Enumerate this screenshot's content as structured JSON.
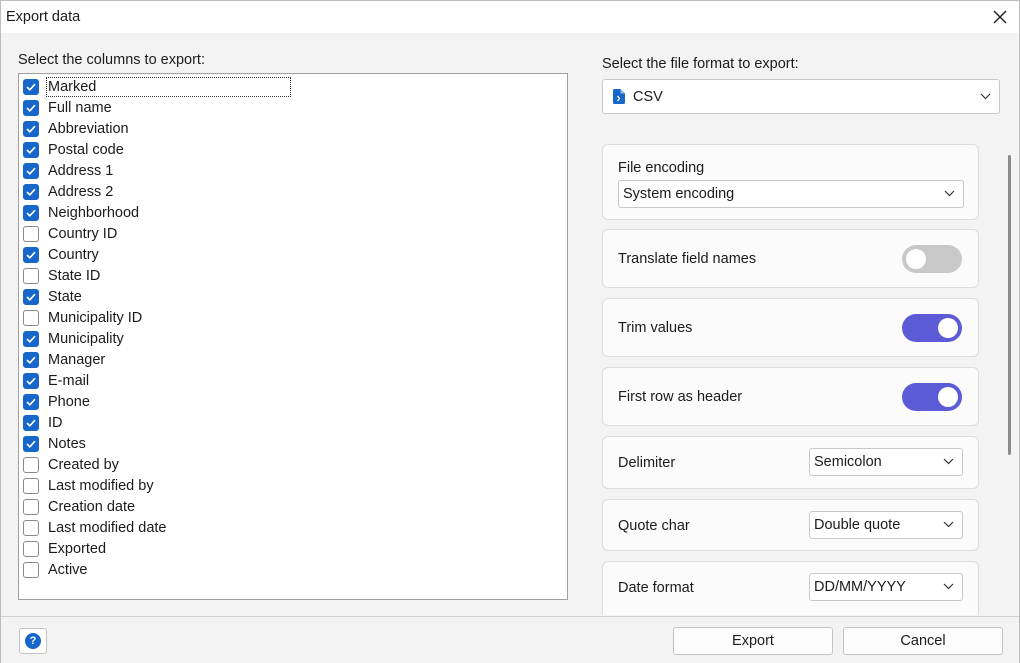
{
  "window": {
    "title": "Export data"
  },
  "columns": {
    "label": "Select the columns to export:",
    "items": [
      {
        "label": "Marked",
        "checked": true
      },
      {
        "label": "Full name",
        "checked": true
      },
      {
        "label": "Abbreviation",
        "checked": true
      },
      {
        "label": "Postal code",
        "checked": true
      },
      {
        "label": "Address 1",
        "checked": true
      },
      {
        "label": "Address 2",
        "checked": true
      },
      {
        "label": "Neighborhood",
        "checked": true
      },
      {
        "label": "Country ID",
        "checked": false
      },
      {
        "label": "Country",
        "checked": true
      },
      {
        "label": "State ID",
        "checked": false
      },
      {
        "label": "State",
        "checked": true
      },
      {
        "label": "Municipality ID",
        "checked": false
      },
      {
        "label": "Municipality",
        "checked": true
      },
      {
        "label": "Manager",
        "checked": true
      },
      {
        "label": "E-mail",
        "checked": true
      },
      {
        "label": "Phone",
        "checked": true
      },
      {
        "label": "ID",
        "checked": true
      },
      {
        "label": "Notes",
        "checked": true
      },
      {
        "label": "Created by",
        "checked": false
      },
      {
        "label": "Last modified by",
        "checked": false
      },
      {
        "label": "Creation date",
        "checked": false
      },
      {
        "label": "Last modified date",
        "checked": false
      },
      {
        "label": "Exported",
        "checked": false
      },
      {
        "label": "Active",
        "checked": false
      }
    ]
  },
  "format": {
    "label": "Select the file format to export:",
    "value": "CSV",
    "icon": "file-code-icon"
  },
  "options": {
    "file_encoding": {
      "label": "File encoding",
      "value": "System encoding"
    },
    "translate_field_names": {
      "label": "Translate field names",
      "on": false
    },
    "trim_values": {
      "label": "Trim values",
      "on": true
    },
    "first_row_header": {
      "label": "First row as header",
      "on": true
    },
    "delimiter": {
      "label": "Delimiter",
      "value": "Semicolon"
    },
    "quote_char": {
      "label": "Quote char",
      "value": "Double quote"
    },
    "date_format": {
      "label": "Date format",
      "value": "DD/MM/YYYY"
    }
  },
  "footer": {
    "help_label": "?",
    "export_label": "Export",
    "cancel_label": "Cancel"
  },
  "colors": {
    "accent": "#1766c9",
    "toggle_on": "#5b5bd6",
    "toggle_off": "#c8c8c8"
  }
}
